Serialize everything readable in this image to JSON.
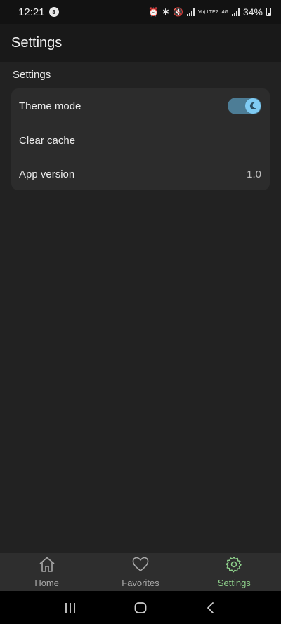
{
  "status_bar": {
    "time": "12:21",
    "notif_badge": "8",
    "volte_label": "Vo) LTE2",
    "network_label": "4G",
    "battery": "34%"
  },
  "app_bar": {
    "title": "Settings"
  },
  "settings": {
    "section_title": "Settings",
    "rows": [
      {
        "label": "Theme mode",
        "toggle_on": true,
        "toggle_icon": "moon-icon"
      },
      {
        "label": "Clear cache"
      },
      {
        "label": "App version",
        "value": "1.0"
      }
    ]
  },
  "bottom_nav": {
    "items": [
      {
        "label": "Home",
        "icon": "home-icon",
        "active": false
      },
      {
        "label": "Favorites",
        "icon": "heart-icon",
        "active": false
      },
      {
        "label": "Settings",
        "icon": "gear-icon",
        "active": true
      }
    ]
  },
  "system_nav": [
    "recent-apps-icon",
    "home-circle-icon",
    "back-icon"
  ],
  "colors": {
    "accent": "#8fd18c",
    "toggle_track": "#4d7d96",
    "toggle_thumb": "#7fcbf3",
    "background": "#222222",
    "card": "#2c2c2c"
  }
}
